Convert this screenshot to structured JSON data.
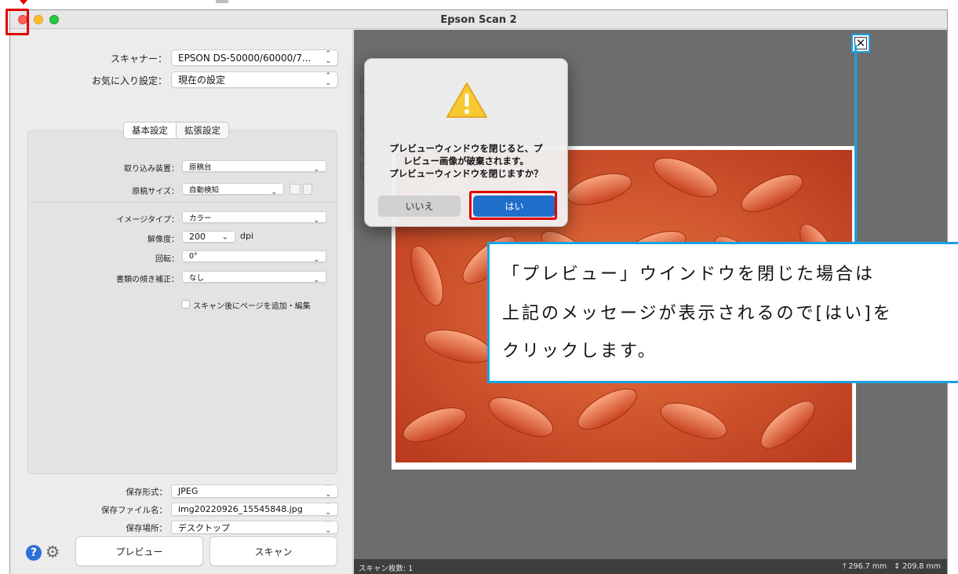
{
  "window": {
    "title": "Epson Scan 2"
  },
  "top": {
    "scanner_label": "スキャナー：",
    "scanner_value": "EPSON DS-50000/60000/7...",
    "favorite_label": "お気に入り設定：",
    "favorite_value": "現在の設定"
  },
  "tabs": {
    "basic": "基本設定",
    "advanced": "拡張設定"
  },
  "settings": {
    "source_label": "取り込み装置：",
    "source_value": "原稿台",
    "doc_size_label": "原稿サイズ：",
    "doc_size_value": "自動検知",
    "image_type_label": "イメージタイプ：",
    "image_type_value": "カラー",
    "resolution_label": "解像度：",
    "resolution_value": "200",
    "resolution_unit": "dpi",
    "rotate_label": "回転：",
    "rotate_value": "0°",
    "skew_label": "書類の傾き補正：",
    "skew_value": "なし",
    "add_page_label": "スキャン後にページを追加・編集"
  },
  "output": {
    "format_label": "保存形式：",
    "format_value": "JPEG",
    "filename_label": "保存ファイル名：",
    "filename_value": "img20220926_15545848.jpg",
    "folder_label": "保存場所：",
    "folder_value": "デスクトップ"
  },
  "buttons": {
    "preview": "プレビュー",
    "scan": "スキャン"
  },
  "status": {
    "scan_count": "スキャン枚数: 1",
    "width": "296.7 mm",
    "height": "209.8 mm"
  },
  "dialog": {
    "message": "プレビューウィンドウを閉じると、プ\nレビュー画像が破棄されます。\nプレビューウィンドウを閉じますか？",
    "no": "いいえ",
    "yes": "はい"
  },
  "callout": {
    "line1": "「プレビュー」ウインドウを閉じた場合は",
    "line2": "上記のメッセージが表示されるので[はい]を",
    "line3": "クリックします。"
  },
  "colors": {
    "annotation_red": "#e00000",
    "annotation_blue": "#19a3e5",
    "dialog_default_button": "#1f6ec9"
  }
}
